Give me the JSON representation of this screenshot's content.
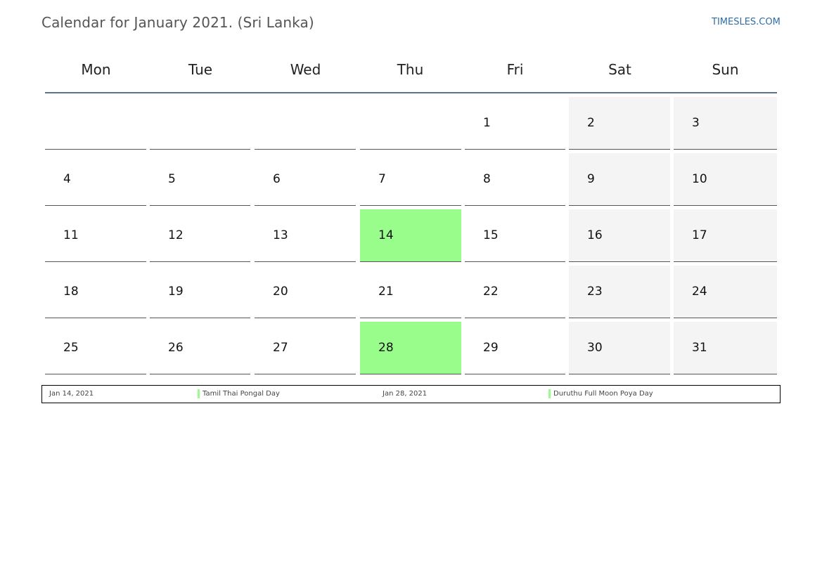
{
  "title": "Calendar for January 2021. (Sri Lanka)",
  "site_link": "TIMESLES.COM",
  "colors": {
    "holiday": "#99fd8c",
    "weekend": "#f4f4f4",
    "header_rule": "#5a7393",
    "link": "#2e6da4"
  },
  "weekdays": [
    "Mon",
    "Tue",
    "Wed",
    "Thu",
    "Fri",
    "Sat",
    "Sun"
  ],
  "weeks": [
    [
      "",
      "",
      "",
      "",
      "1",
      "2",
      "3"
    ],
    [
      "4",
      "5",
      "6",
      "7",
      "8",
      "9",
      "10"
    ],
    [
      "11",
      "12",
      "13",
      "14",
      "15",
      "16",
      "17"
    ],
    [
      "18",
      "19",
      "20",
      "21",
      "22",
      "23",
      "24"
    ],
    [
      "25",
      "26",
      "27",
      "28",
      "29",
      "30",
      "31"
    ]
  ],
  "holiday_days": [
    "14",
    "28"
  ],
  "holidays": [
    {
      "date": "Jan 14, 2021",
      "name": "Tamil Thai Pongal Day"
    },
    {
      "date": "Jan 28, 2021",
      "name": "Duruthu Full Moon Poya Day"
    }
  ]
}
